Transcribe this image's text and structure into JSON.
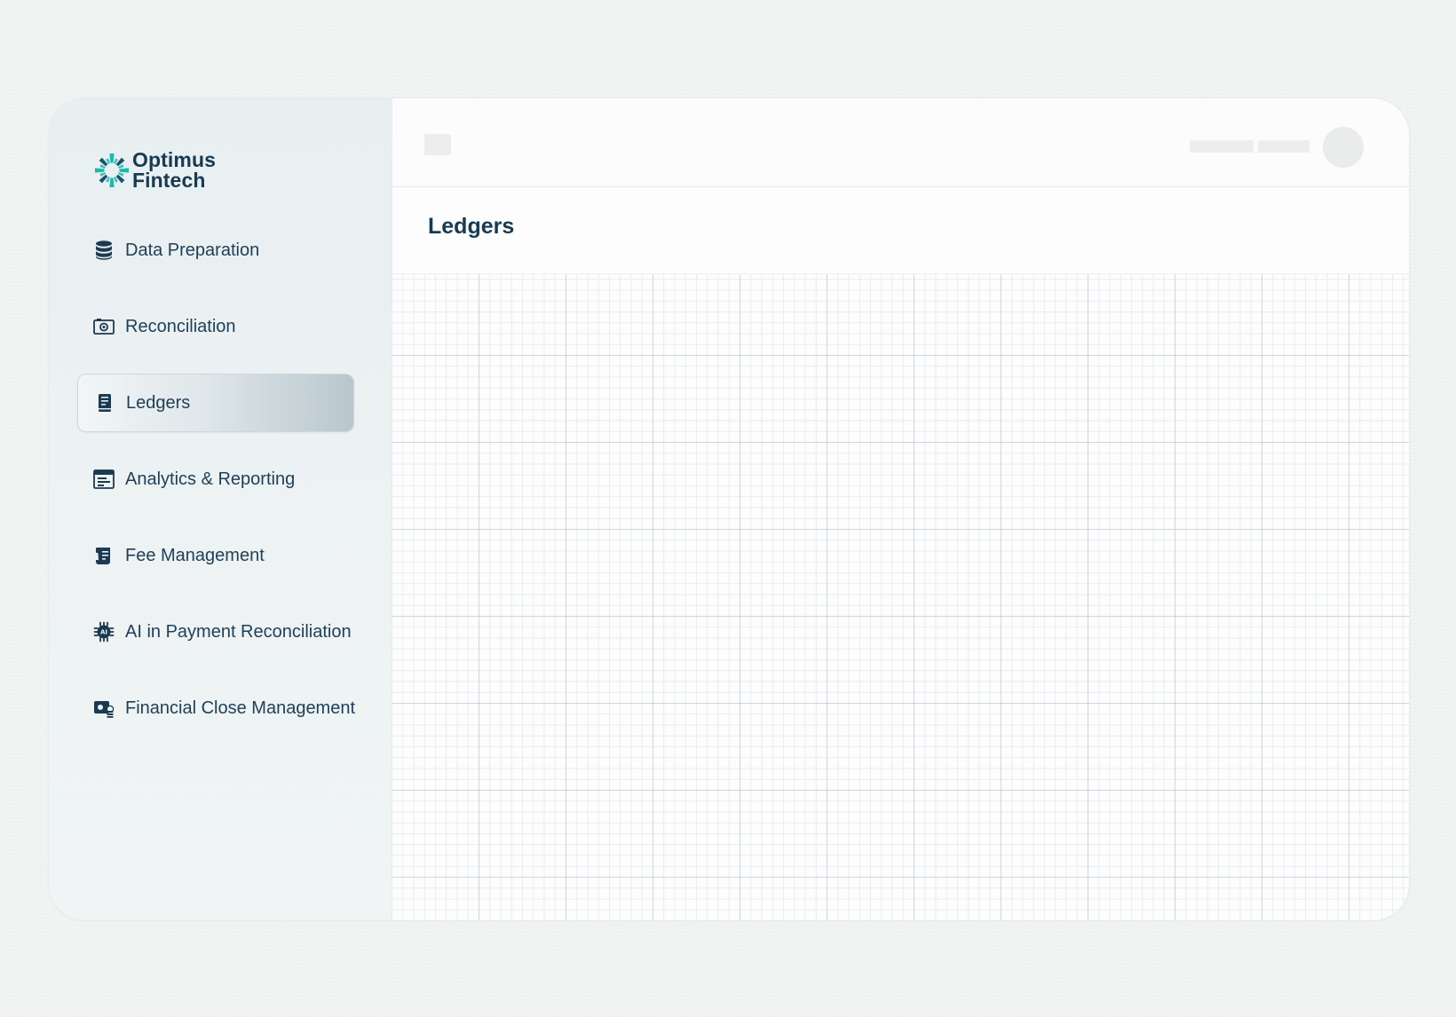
{
  "brand": {
    "line1": "Optimus",
    "line2": "Fintech",
    "logo_icon": "starburst-logo-icon",
    "colors": {
      "text": "#173a52",
      "teal": "#1fb8ad",
      "navy": "#1b5272"
    }
  },
  "sidebar": {
    "active_item": "Ledgers",
    "items": [
      {
        "label": "Data Preparation",
        "icon": "database-icon"
      },
      {
        "label": "Reconciliation",
        "icon": "camera-gear-icon"
      },
      {
        "label": "Ledgers",
        "icon": "ledger-book-icon"
      },
      {
        "label": "Analytics & Reporting",
        "icon": "report-window-icon"
      },
      {
        "label": "Fee Management",
        "icon": "receipt-scroll-icon"
      },
      {
        "label": "AI in Payment Reconciliation",
        "icon": "ai-chip-icon"
      },
      {
        "label": "Financial Close Management",
        "icon": "wallet-stack-icon"
      }
    ]
  },
  "main": {
    "title": "Ledgers"
  }
}
